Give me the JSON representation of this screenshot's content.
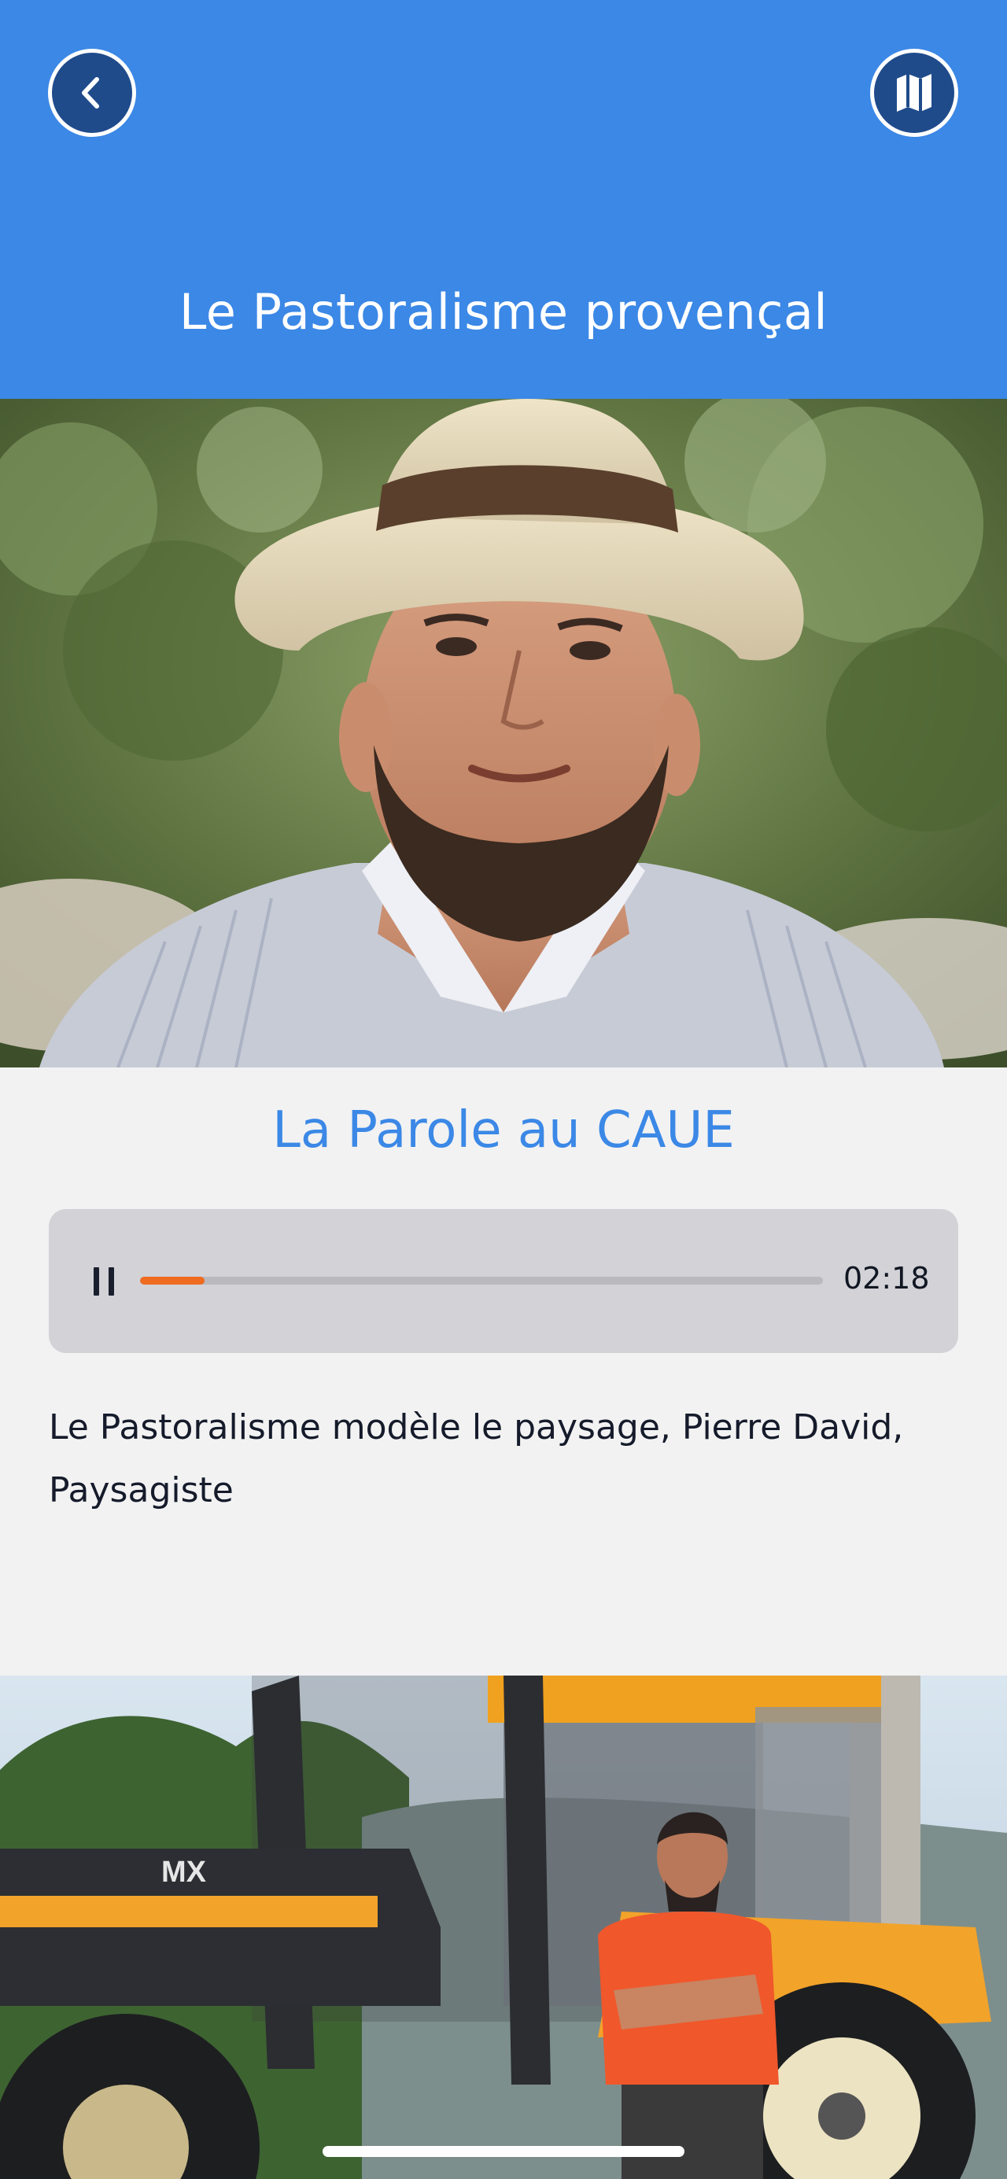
{
  "header": {
    "title": "Le Pastoralisme provençal",
    "background_color": "#3b88e6",
    "back_button_icon": "chevron-left-icon",
    "map_button_icon": "map-icon"
  },
  "section": {
    "title": "La Parole au CAUE"
  },
  "audio_player": {
    "state": "playing",
    "pause_icon": "pause-icon",
    "time_display": "02:18",
    "progress_fraction": 0.095,
    "progress_color": "#ef6b1f"
  },
  "description": "Le Pastoralisme modèle le paysage, Pierre David, Paysagiste",
  "images": [
    {
      "subject": "man-wearing-straw-hat-photo"
    },
    {
      "subject": "man-standing-by-tractor-photo"
    }
  ]
}
